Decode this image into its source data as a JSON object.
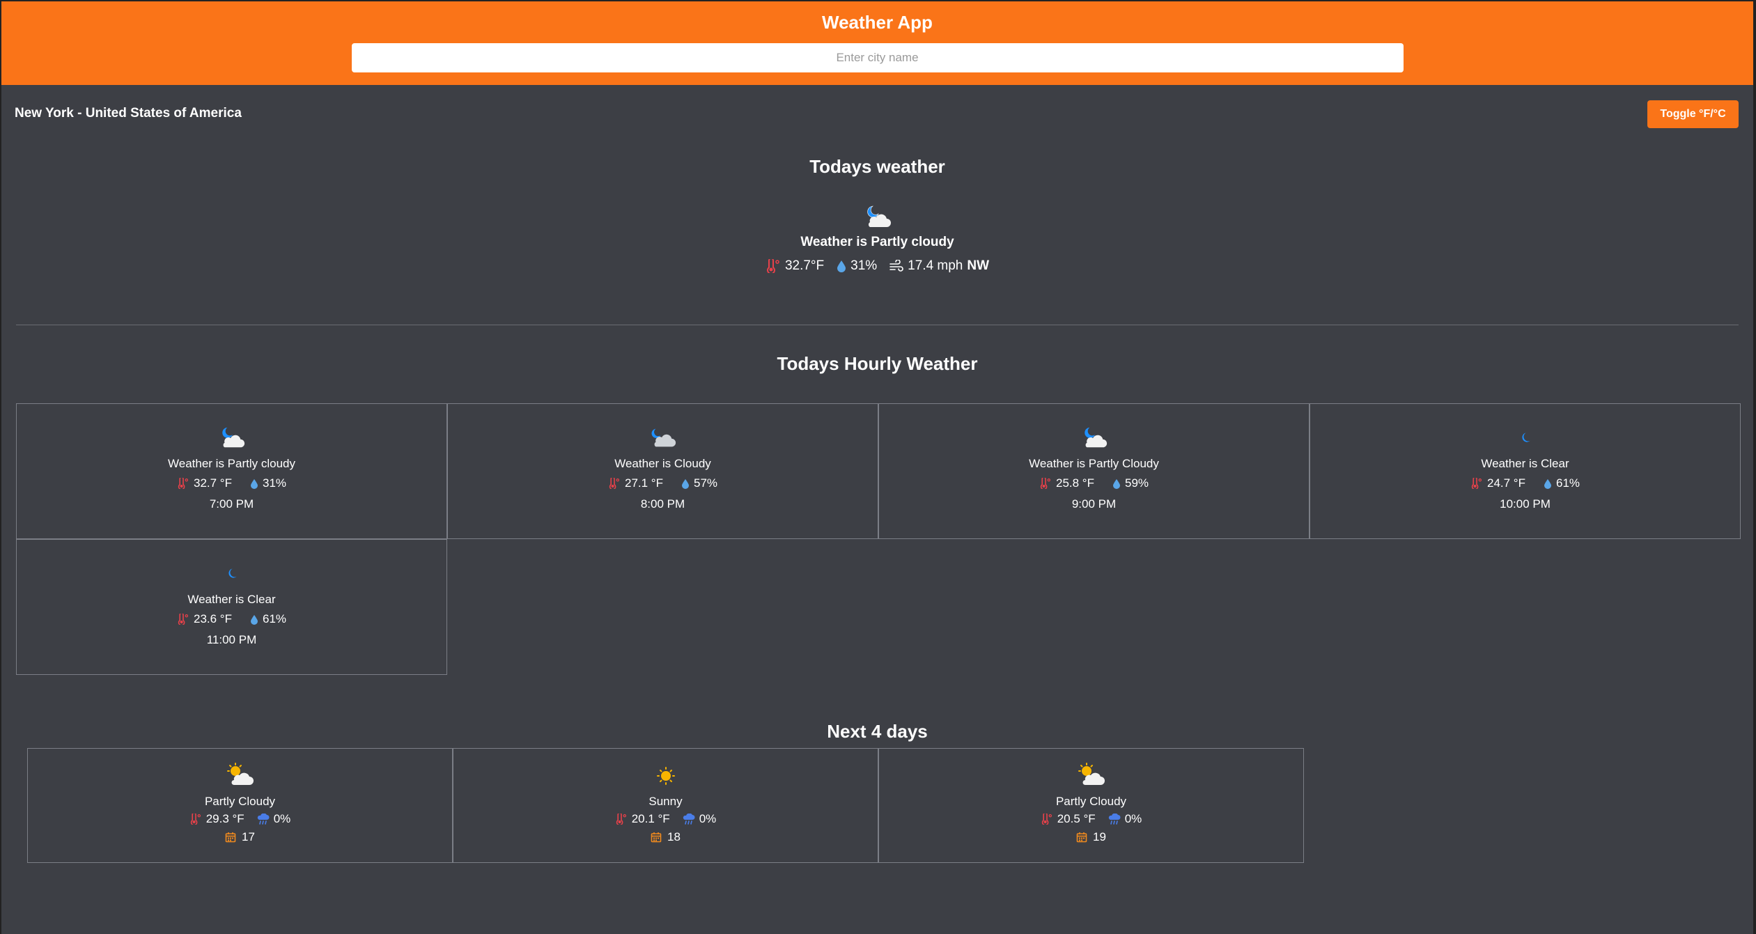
{
  "header": {
    "title": "Weather App",
    "search_placeholder": "Enter city name"
  },
  "location": "New York - United States of America",
  "toggle_label": "Toggle °F/°C",
  "today": {
    "section_title": "Todays weather",
    "icon": "night-partly-cloudy-icon",
    "description": "Weather is Partly cloudy",
    "temperature": "32.7°F",
    "humidity": "31%",
    "wind_speed": "17.4 mph",
    "wind_dir": "NW"
  },
  "hourly": {
    "section_title": "Todays Hourly Weather",
    "items": [
      {
        "icon": "night-partly-cloudy-icon",
        "description": "Weather is Partly cloudy",
        "temp": "32.7 °F",
        "humidity": "31%",
        "time": "7:00 PM"
      },
      {
        "icon": "night-cloudy-icon",
        "description": "Weather is Cloudy",
        "temp": "27.1 °F",
        "humidity": "57%",
        "time": "8:00 PM"
      },
      {
        "icon": "night-partly-cloudy-icon",
        "description": "Weather is Partly Cloudy",
        "temp": "25.8 °F",
        "humidity": "59%",
        "time": "9:00 PM"
      },
      {
        "icon": "moon-icon",
        "description": "Weather is Clear",
        "temp": "24.7 °F",
        "humidity": "61%",
        "time": "10:00 PM"
      },
      {
        "icon": "moon-icon",
        "description": "Weather is Clear",
        "temp": "23.6 °F",
        "humidity": "61%",
        "time": "11:00 PM"
      }
    ]
  },
  "forecast": {
    "section_title": "Next 4 days",
    "items": [
      {
        "icon": "sun-cloud-icon",
        "description": "Partly Cloudy",
        "temp": "29.3 °F",
        "rain": "0%",
        "day": "17"
      },
      {
        "icon": "sun-icon",
        "description": "Sunny",
        "temp": "20.1 °F",
        "rain": "0%",
        "day": "18"
      },
      {
        "icon": "sun-cloud-icon",
        "description": "Partly Cloudy",
        "temp": "20.5 °F",
        "rain": "0%",
        "day": "19"
      }
    ]
  },
  "colors": {
    "accent": "#fa7418",
    "background": "#3d3f45",
    "thermometer": "#e8414a",
    "droplet": "#5aa6e8",
    "rain": "#4a7de8",
    "calendar": "#f08a1e"
  }
}
